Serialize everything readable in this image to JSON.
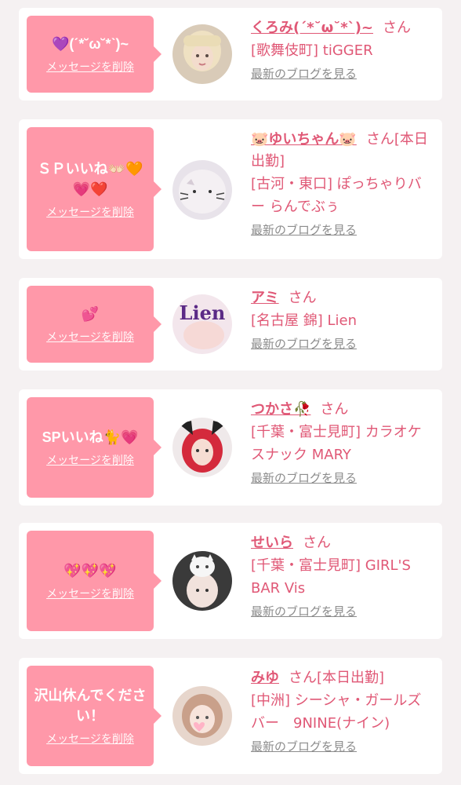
{
  "entries": [
    {
      "message": "💜(ˊ*˘ω˘*ˋ)~",
      "delete_label": "メッセージを削除",
      "name": "くろみ(ˊ*˘ω˘*ˋ)~",
      "san": "さん",
      "shop": "[歌舞伎町] tiGGER",
      "blog_label": "最新のブログを見る"
    },
    {
      "message": "ＳＰいいね👐🏻🧡💗❤️",
      "delete_label": "メッセージを削除",
      "name": "🐷ゆいちゃん🐷",
      "san": "さん[本日出勤]",
      "shop": "[古河・東口] ぽっちゃりバー らんでぶぅ",
      "blog_label": "最新のブログを見る"
    },
    {
      "message": "💕",
      "delete_label": "メッセージを削除",
      "name": "アミ",
      "san": "さん",
      "shop": "[名古屋 錦] Lien",
      "blog_label": "最新のブログを見る"
    },
    {
      "message": "SPいいね🐈💗",
      "delete_label": "メッセージを削除",
      "name": "つかさ🥀",
      "san": "さん",
      "shop": "[千葉・富士見町] カラオケスナック MARY",
      "blog_label": "最新のブログを見る"
    },
    {
      "message": "💖💖💖",
      "delete_label": "メッセージを削除",
      "name": "せいら",
      "san": "さん",
      "shop": "[千葉・富士見町] GIRL'S BAR Vis",
      "blog_label": "最新のブログを見る"
    },
    {
      "message": "沢山休んでください！",
      "delete_label": "メッセージを削除",
      "name": "みゆ",
      "san": "さん[本日出勤]",
      "shop": "[中洲] シーシャ・ガールズバー　9NINE(ナイン)",
      "blog_label": "最新のブログを見る"
    }
  ],
  "avatar_logo_text": "Lien",
  "colors": {
    "accent": "#e05876",
    "bubble": "#ff98a9",
    "background": "#f5f1f2",
    "link_gray": "#8c8c8c"
  }
}
